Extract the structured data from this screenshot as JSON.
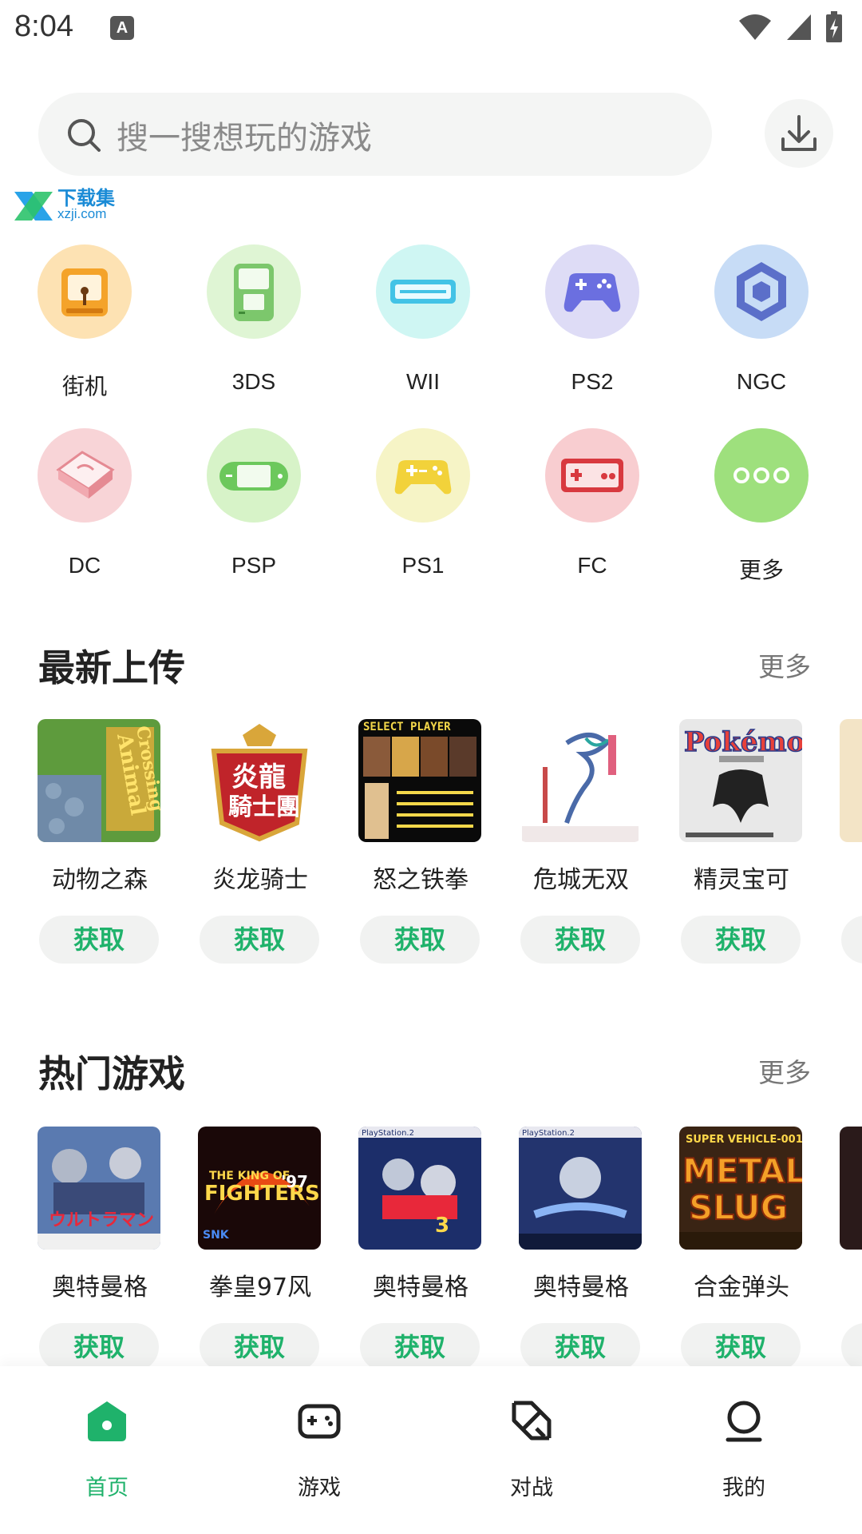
{
  "status_bar": {
    "time": "8:04",
    "notification_icon": "A"
  },
  "search": {
    "placeholder": "搜一搜想玩的游戏"
  },
  "watermark": {
    "title": "下载集",
    "url": "xzji.com"
  },
  "categories": [
    {
      "label": "街机",
      "icon": "arcade-icon",
      "color": "#fde2b3"
    },
    {
      "label": "3DS",
      "icon": "3ds-icon",
      "color": "#dff5d4"
    },
    {
      "label": "WII",
      "icon": "wii-icon",
      "color": "#cff6f3"
    },
    {
      "label": "PS2",
      "icon": "ps2-icon",
      "color": "#dedcf6"
    },
    {
      "label": "NGC",
      "icon": "ngc-icon",
      "color": "#c7dcf6"
    },
    {
      "label": "DC",
      "icon": "dc-icon",
      "color": "#f8d4d7"
    },
    {
      "label": "PSP",
      "icon": "psp-icon",
      "color": "#d7f3c8"
    },
    {
      "label": "PS1",
      "icon": "ps1-icon",
      "color": "#f6f4c6"
    },
    {
      "label": "FC",
      "icon": "fc-icon",
      "color": "#f8cdd0"
    },
    {
      "label": "更多",
      "icon": "more-icon",
      "color": "#9ee07d"
    }
  ],
  "sections": {
    "latest": {
      "title": "最新上传",
      "more": "更多",
      "games": [
        {
          "name": "动物之森",
          "action": "获取"
        },
        {
          "name": "炎龙骑士",
          "action": "获取"
        },
        {
          "name": "怒之铁拳",
          "action": "获取"
        },
        {
          "name": "危城无双",
          "action": "获取"
        },
        {
          "name": "精灵宝可",
          "action": "获取"
        }
      ]
    },
    "hot": {
      "title": "热门游戏",
      "more": "更多",
      "games": [
        {
          "name": "奥特曼格",
          "action": "获取"
        },
        {
          "name": "拳皇97风",
          "action": "获取"
        },
        {
          "name": "奥特曼格",
          "action": "获取"
        },
        {
          "name": "奥特曼格",
          "action": "获取"
        },
        {
          "name": "合金弹头",
          "action": "获取"
        }
      ]
    }
  },
  "bottom_nav": [
    {
      "label": "首页",
      "icon": "home-icon",
      "active": true
    },
    {
      "label": "游戏",
      "icon": "gamepad-icon",
      "active": false
    },
    {
      "label": "对战",
      "icon": "battle-icon",
      "active": false
    },
    {
      "label": "我的",
      "icon": "profile-icon",
      "active": false
    }
  ],
  "colors": {
    "accent": "#1fb26b",
    "chip_bg": "#f1f2f1",
    "search_bg": "#f4f5f4"
  }
}
